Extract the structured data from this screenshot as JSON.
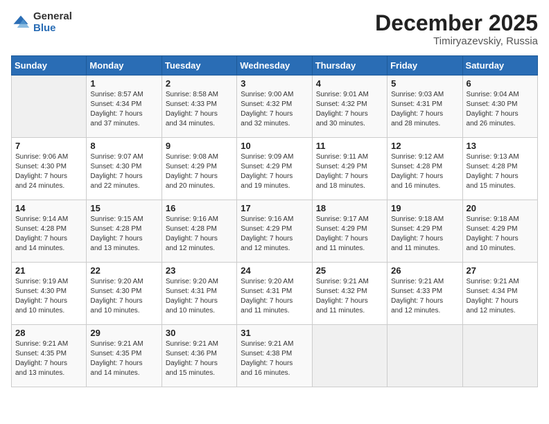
{
  "logo": {
    "general": "General",
    "blue": "Blue"
  },
  "header": {
    "month": "December 2025",
    "location": "Timiryazevskiy, Russia"
  },
  "weekdays": [
    "Sunday",
    "Monday",
    "Tuesday",
    "Wednesday",
    "Thursday",
    "Friday",
    "Saturday"
  ],
  "weeks": [
    [
      {
        "day": "",
        "info": ""
      },
      {
        "day": "1",
        "info": "Sunrise: 8:57 AM\nSunset: 4:34 PM\nDaylight: 7 hours\nand 37 minutes."
      },
      {
        "day": "2",
        "info": "Sunrise: 8:58 AM\nSunset: 4:33 PM\nDaylight: 7 hours\nand 34 minutes."
      },
      {
        "day": "3",
        "info": "Sunrise: 9:00 AM\nSunset: 4:32 PM\nDaylight: 7 hours\nand 32 minutes."
      },
      {
        "day": "4",
        "info": "Sunrise: 9:01 AM\nSunset: 4:32 PM\nDaylight: 7 hours\nand 30 minutes."
      },
      {
        "day": "5",
        "info": "Sunrise: 9:03 AM\nSunset: 4:31 PM\nDaylight: 7 hours\nand 28 minutes."
      },
      {
        "day": "6",
        "info": "Sunrise: 9:04 AM\nSunset: 4:30 PM\nDaylight: 7 hours\nand 26 minutes."
      }
    ],
    [
      {
        "day": "7",
        "info": "Sunrise: 9:06 AM\nSunset: 4:30 PM\nDaylight: 7 hours\nand 24 minutes."
      },
      {
        "day": "8",
        "info": "Sunrise: 9:07 AM\nSunset: 4:30 PM\nDaylight: 7 hours\nand 22 minutes."
      },
      {
        "day": "9",
        "info": "Sunrise: 9:08 AM\nSunset: 4:29 PM\nDaylight: 7 hours\nand 20 minutes."
      },
      {
        "day": "10",
        "info": "Sunrise: 9:09 AM\nSunset: 4:29 PM\nDaylight: 7 hours\nand 19 minutes."
      },
      {
        "day": "11",
        "info": "Sunrise: 9:11 AM\nSunset: 4:29 PM\nDaylight: 7 hours\nand 18 minutes."
      },
      {
        "day": "12",
        "info": "Sunrise: 9:12 AM\nSunset: 4:28 PM\nDaylight: 7 hours\nand 16 minutes."
      },
      {
        "day": "13",
        "info": "Sunrise: 9:13 AM\nSunset: 4:28 PM\nDaylight: 7 hours\nand 15 minutes."
      }
    ],
    [
      {
        "day": "14",
        "info": "Sunrise: 9:14 AM\nSunset: 4:28 PM\nDaylight: 7 hours\nand 14 minutes."
      },
      {
        "day": "15",
        "info": "Sunrise: 9:15 AM\nSunset: 4:28 PM\nDaylight: 7 hours\nand 13 minutes."
      },
      {
        "day": "16",
        "info": "Sunrise: 9:16 AM\nSunset: 4:28 PM\nDaylight: 7 hours\nand 12 minutes."
      },
      {
        "day": "17",
        "info": "Sunrise: 9:16 AM\nSunset: 4:29 PM\nDaylight: 7 hours\nand 12 minutes."
      },
      {
        "day": "18",
        "info": "Sunrise: 9:17 AM\nSunset: 4:29 PM\nDaylight: 7 hours\nand 11 minutes."
      },
      {
        "day": "19",
        "info": "Sunrise: 9:18 AM\nSunset: 4:29 PM\nDaylight: 7 hours\nand 11 minutes."
      },
      {
        "day": "20",
        "info": "Sunrise: 9:18 AM\nSunset: 4:29 PM\nDaylight: 7 hours\nand 10 minutes."
      }
    ],
    [
      {
        "day": "21",
        "info": "Sunrise: 9:19 AM\nSunset: 4:30 PM\nDaylight: 7 hours\nand 10 minutes."
      },
      {
        "day": "22",
        "info": "Sunrise: 9:20 AM\nSunset: 4:30 PM\nDaylight: 7 hours\nand 10 minutes."
      },
      {
        "day": "23",
        "info": "Sunrise: 9:20 AM\nSunset: 4:31 PM\nDaylight: 7 hours\nand 10 minutes."
      },
      {
        "day": "24",
        "info": "Sunrise: 9:20 AM\nSunset: 4:31 PM\nDaylight: 7 hours\nand 11 minutes."
      },
      {
        "day": "25",
        "info": "Sunrise: 9:21 AM\nSunset: 4:32 PM\nDaylight: 7 hours\nand 11 minutes."
      },
      {
        "day": "26",
        "info": "Sunrise: 9:21 AM\nSunset: 4:33 PM\nDaylight: 7 hours\nand 12 minutes."
      },
      {
        "day": "27",
        "info": "Sunrise: 9:21 AM\nSunset: 4:34 PM\nDaylight: 7 hours\nand 12 minutes."
      }
    ],
    [
      {
        "day": "28",
        "info": "Sunrise: 9:21 AM\nSunset: 4:35 PM\nDaylight: 7 hours\nand 13 minutes."
      },
      {
        "day": "29",
        "info": "Sunrise: 9:21 AM\nSunset: 4:35 PM\nDaylight: 7 hours\nand 14 minutes."
      },
      {
        "day": "30",
        "info": "Sunrise: 9:21 AM\nSunset: 4:36 PM\nDaylight: 7 hours\nand 15 minutes."
      },
      {
        "day": "31",
        "info": "Sunrise: 9:21 AM\nSunset: 4:38 PM\nDaylight: 7 hours\nand 16 minutes."
      },
      {
        "day": "",
        "info": ""
      },
      {
        "day": "",
        "info": ""
      },
      {
        "day": "",
        "info": ""
      }
    ]
  ]
}
